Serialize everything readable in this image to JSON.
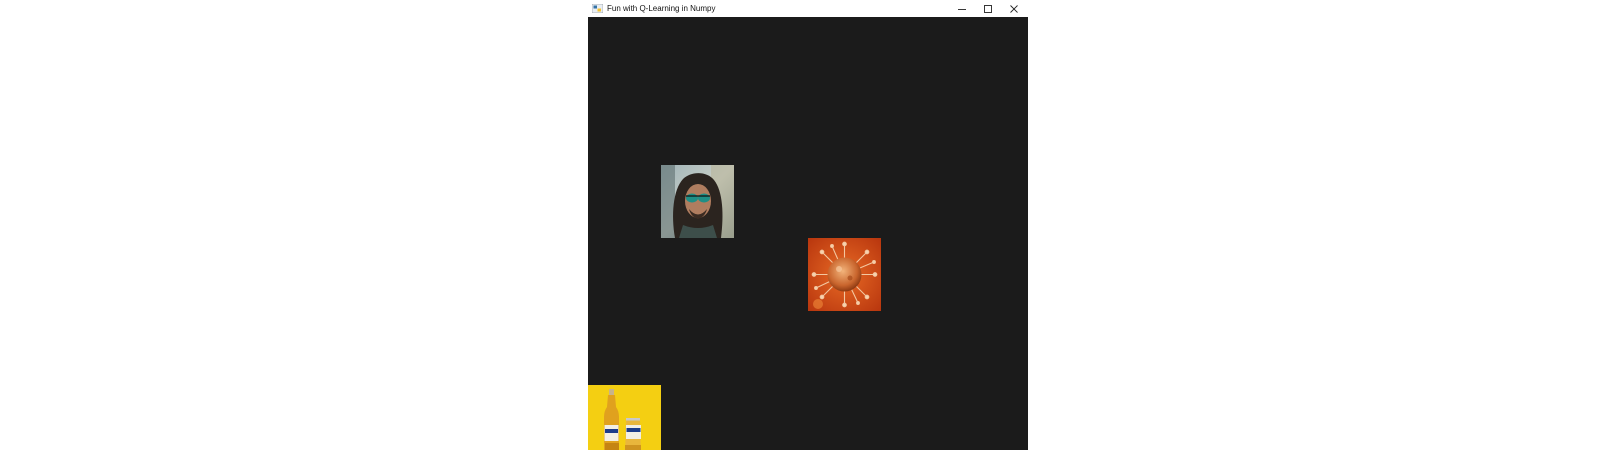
{
  "window": {
    "title": "Fun with Q-Learning in Numpy",
    "app_icon": "python-icon",
    "controls": {
      "minimize_icon": "minimize-icon",
      "maximize_icon": "maximize-icon",
      "close_icon": "close-icon"
    }
  },
  "game": {
    "background_color": "#1b1b1b",
    "grid_columns": 6,
    "grid_rows": 6,
    "sprites": [
      {
        "role": "player",
        "depicts": "portrait of man with sunglasses and long hair",
        "column": 1,
        "row": 2
      },
      {
        "role": "enemy",
        "depicts": "orange coronavirus particle",
        "column": 3,
        "row": 3
      },
      {
        "role": "goal",
        "depicts": "two Corona beer bottles on yellow background",
        "column": 0,
        "row": 5
      }
    ]
  },
  "colors": {
    "titlebar": "#ffffff",
    "board": "#1b1b1b",
    "beer_background": "#f4cf12",
    "virus_background": "#d8501a"
  }
}
